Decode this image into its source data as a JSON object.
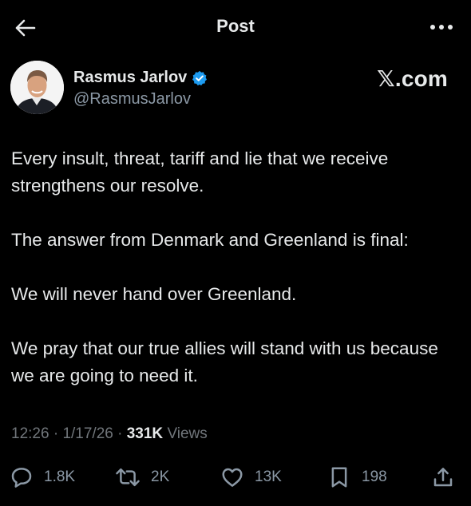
{
  "header": {
    "title": "Post"
  },
  "author": {
    "display_name": "Rasmus Jarlov",
    "handle": "@RasmusJarlov",
    "verified": true
  },
  "watermark": "𝕏.com",
  "tweet": {
    "paragraphs": [
      "Every insult, threat, tariff and lie that we receive strengthens our resolve.",
      "The answer from Denmark and Greenland is final:",
      "We will never hand over Greenland.",
      "We pray that our true allies will stand with us because we are going to need it."
    ]
  },
  "meta": {
    "time": "12:26",
    "separator": " · ",
    "date": "1/17/26",
    "views_count": "331K",
    "views_label": "Views"
  },
  "actions": {
    "reply_count": "1.8K",
    "repost_count": "2K",
    "like_count": "13K",
    "bookmark_count": "198"
  },
  "colors": {
    "background": "#000000",
    "text": "#e7e9ea",
    "muted": "#71767b",
    "verified_badge": "#1d9bf0"
  },
  "icons": [
    "back-arrow-icon",
    "more-icon",
    "verified-badge-icon",
    "reply-icon",
    "repost-icon",
    "like-icon",
    "bookmark-icon",
    "share-icon"
  ]
}
